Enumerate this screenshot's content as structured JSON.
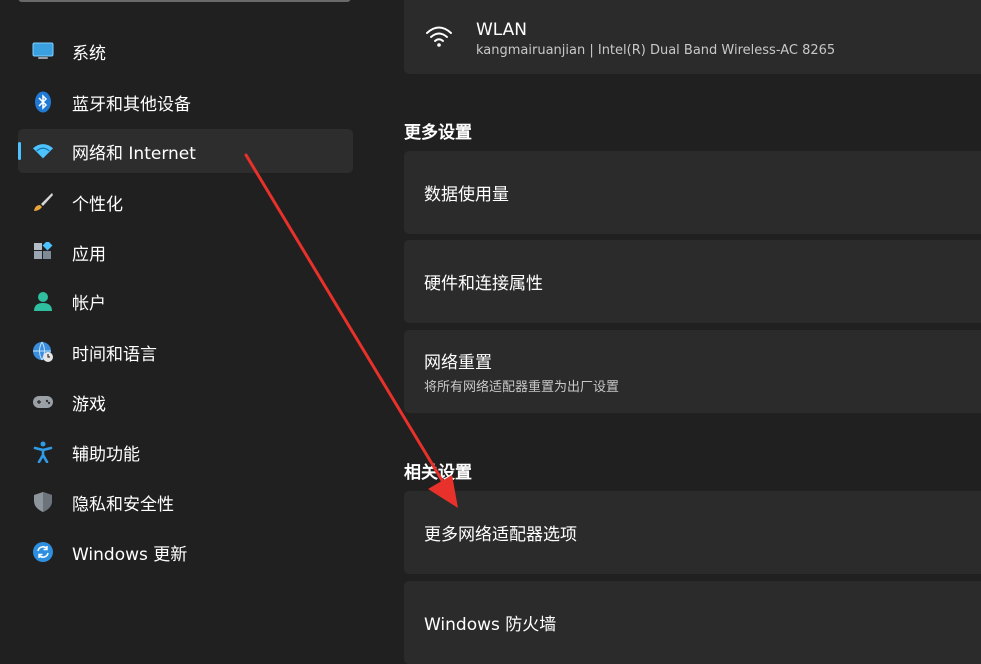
{
  "sidebar": {
    "items": [
      {
        "label": "系统",
        "icon": "display-icon"
      },
      {
        "label": "蓝牙和其他设备",
        "icon": "bluetooth-icon"
      },
      {
        "label": "网络和 Internet",
        "icon": "wifi-icon",
        "active": true
      },
      {
        "label": "个性化",
        "icon": "brush-icon"
      },
      {
        "label": "应用",
        "icon": "apps-icon"
      },
      {
        "label": "帐户",
        "icon": "person-icon"
      },
      {
        "label": "时间和语言",
        "icon": "globe-clock-icon"
      },
      {
        "label": "游戏",
        "icon": "gamepad-icon"
      },
      {
        "label": "辅助功能",
        "icon": "accessibility-icon"
      },
      {
        "label": "隐私和安全性",
        "icon": "shield-icon"
      },
      {
        "label": "Windows 更新",
        "icon": "update-icon"
      }
    ]
  },
  "main": {
    "wlan": {
      "title": "WLAN",
      "subtitle": "kangmairuanjian | Intel(R) Dual Band Wireless-AC 8265"
    },
    "more_settings": {
      "heading": "更多设置",
      "items": [
        {
          "title": "数据使用量"
        },
        {
          "title": "硬件和连接属性"
        },
        {
          "title": "网络重置",
          "subtitle": "将所有网络适配器重置为出厂设置"
        }
      ]
    },
    "related_settings": {
      "heading": "相关设置",
      "items": [
        {
          "title": "更多网络适配器选项"
        },
        {
          "title": "Windows 防火墙"
        }
      ]
    }
  },
  "colors": {
    "background": "#202020",
    "card": "#2b2b2b",
    "accent": "#4cc2ff",
    "annotation_arrow": "#e8312a"
  }
}
